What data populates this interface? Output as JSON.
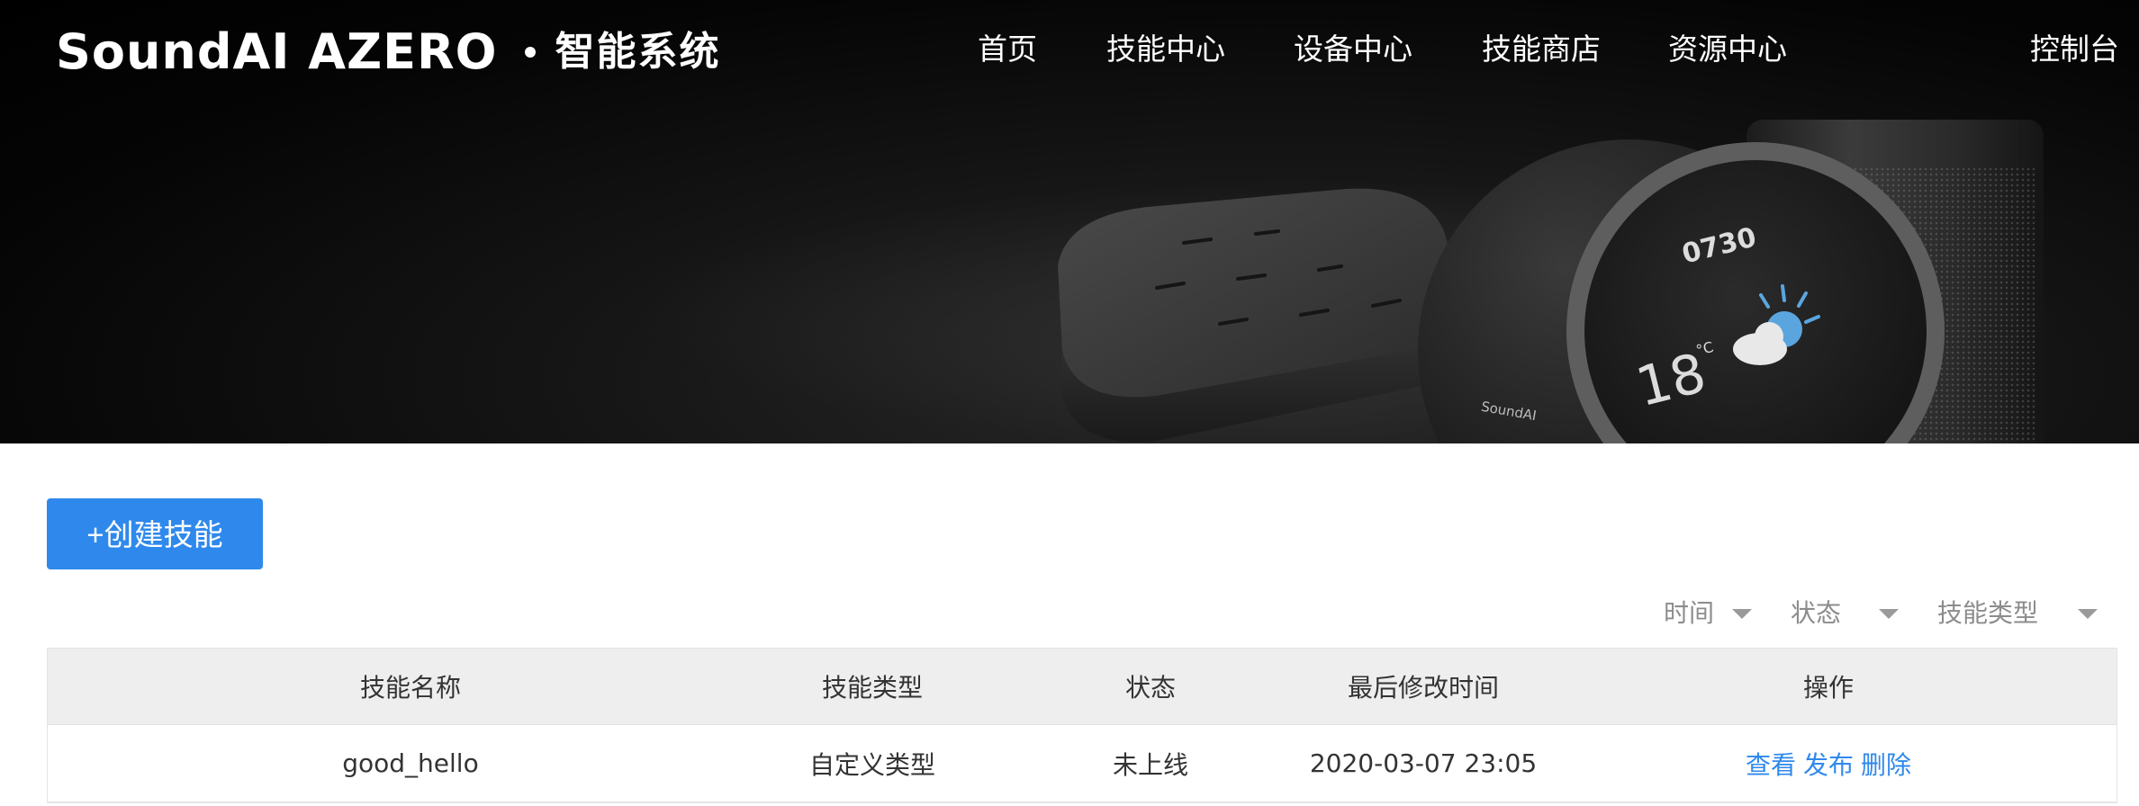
{
  "header": {
    "logo": "SoundAI AZERO",
    "logo_sub": "智能系统",
    "nav": [
      {
        "label": "首页"
      },
      {
        "label": "技能中心"
      },
      {
        "label": "设备中心"
      },
      {
        "label": "技能商店"
      },
      {
        "label": "资源中心"
      }
    ],
    "console": "控制台"
  },
  "hero": {
    "clock": "0730",
    "temperature": "18",
    "temp_unit": "°C",
    "device_brand": "SoundAI"
  },
  "toolbar": {
    "create_label": "+创建技能"
  },
  "filters": [
    {
      "label": "时间"
    },
    {
      "label": "状态"
    },
    {
      "label": "技能类型"
    }
  ],
  "table": {
    "columns": [
      "技能名称",
      "技能类型",
      "状态",
      "最后修改时间",
      "操作"
    ],
    "rows": [
      {
        "name": "good_hello",
        "type": "自定义类型",
        "status": "未上线",
        "modified": "2020-03-07 23:05",
        "actions": [
          "查看",
          "发布",
          "删除"
        ]
      }
    ]
  },
  "colors": {
    "accent": "#2f89ec",
    "header_bg": "#000000",
    "table_header_bg": "#eeeeee"
  }
}
